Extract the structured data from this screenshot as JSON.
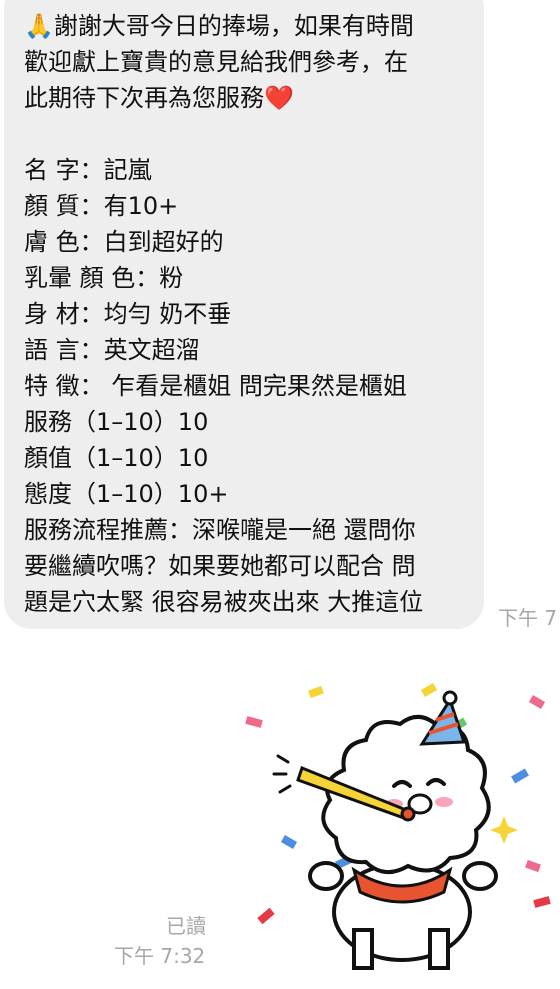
{
  "message": {
    "lines": [
      "🙏謝謝大哥今日的捧場，如果有時間",
      "歡迎獻上寶貴的意見給我們參考，在",
      "此期待下次再為您服務",
      "",
      "名 字：記嵐",
      "顏 質：有10+",
      "膚 色：白到超好的",
      "乳暈 顏 色：粉",
      "身 材：均勻 奶不垂",
      "語 言：英文超溜",
      "特 徵： 乍看是櫃姐 問完果然是櫃姐",
      "服務（1–10）10",
      "顏值（1–10）10",
      "態度（1–10）10+",
      "服務流程推薦：深喉嚨是一絕 還問你",
      "要繼續吹嗎？如果要她都可以配合 問",
      "題是穴太緊 很容易被夾出來 大推這位"
    ],
    "heart_emoji": "❤️",
    "time": "下午 7"
  },
  "sticker": {
    "icon": "party-bear-sticker-icon",
    "read_label": "已讀",
    "time": "下午 7:32"
  }
}
